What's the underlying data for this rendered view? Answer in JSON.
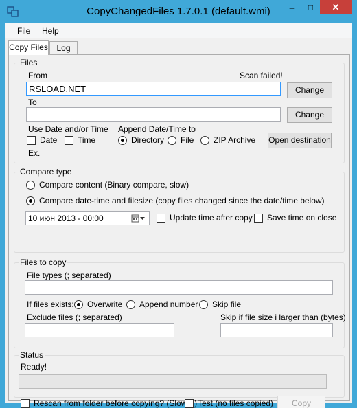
{
  "window": {
    "title": "CopyChangedFiles 1.7.0.1 (default.wmi)",
    "min_glyph": "–",
    "max_glyph": "□",
    "close_glyph": "✕"
  },
  "menu": {
    "file": "File",
    "help": "Help"
  },
  "tabs": {
    "copy_files": "Copy Files",
    "log": "Log"
  },
  "files_group": {
    "title": "Files",
    "from_label": "From",
    "scan_status": "Scan failed!",
    "from_value": "RSLOAD.NET",
    "change_label": "Change",
    "to_label": "To",
    "to_value": "",
    "use_date_label": "Use Date and/or Time",
    "date_label": "Date",
    "time_label": "Time",
    "append_label": "Append Date/Time to",
    "directory_label": "Directory",
    "file_label": "File",
    "zip_label": "ZIP Archive",
    "open_destination": "Open destination",
    "example_label": "Ex."
  },
  "compare_group": {
    "title": "Compare type",
    "content_label": "Compare content (Binary compare, slow)",
    "datetime_label": "Compare date-time and filesize (copy files changed since the date/time below)",
    "date_value": "10   июн   2013   -   00:00",
    "update_time_label": "Update time after copy.",
    "save_time_label": "Save time on close"
  },
  "copy_group": {
    "title": "Files to copy",
    "file_types_label": "File types (; separated)",
    "file_types_value": "",
    "if_exists_label": "If files exists:",
    "overwrite_label": "Overwrite",
    "append_number_label": "Append number",
    "skip_file_label": "Skip file",
    "exclude_label": "Exclude files (; separated)",
    "exclude_value": "",
    "skip_size_label": "Skip if file size i larger than (bytes)",
    "skip_size_value": ""
  },
  "status_group": {
    "title": "Status",
    "status_text": "Ready!",
    "progress_fraction": 0,
    "rescan_label": "Rescan from folder before copying? (Slower)",
    "test_label": "Test (no files copied)",
    "copy_label": "Copy"
  },
  "colors": {
    "titlebar": "#40a8d8",
    "close_button": "#c7403a",
    "focus_border": "#3399ff"
  }
}
